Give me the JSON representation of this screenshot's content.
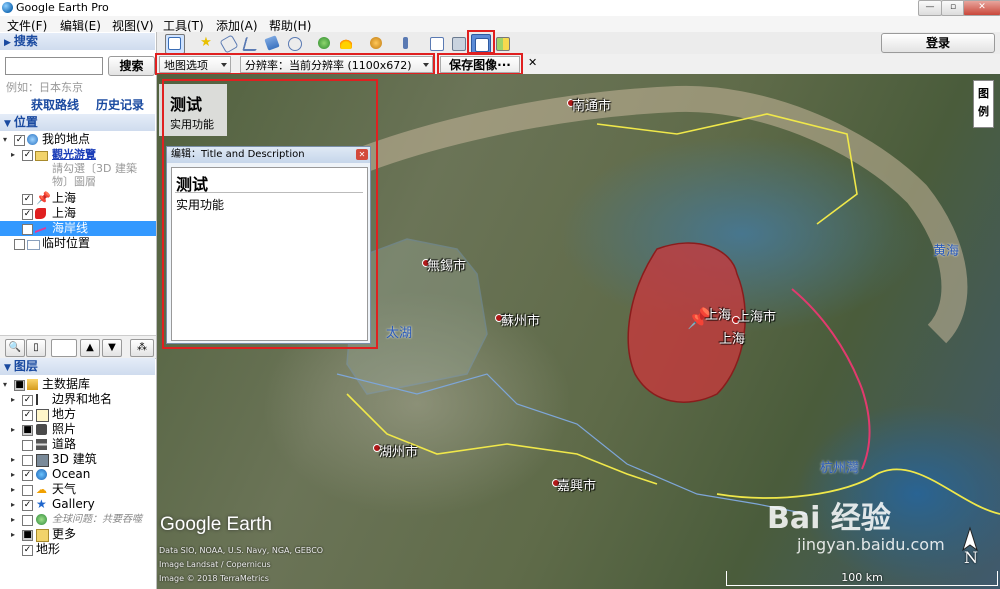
{
  "window": {
    "title": "Google Earth Pro",
    "min_label": "—",
    "max_label": "▫",
    "close_label": "✕"
  },
  "menu": [
    "文件(F)",
    "编辑(E)",
    "视图(V)",
    "工具(T)",
    "添加(A)",
    "帮助(H)"
  ],
  "toolbar": {
    "login_label": "登录"
  },
  "save_row": {
    "map_options": "地图选项",
    "resolution": "分辨率：当前分辨率 (1100x672)",
    "save_label": "保存图像···",
    "close_label": "✕"
  },
  "search": {
    "header": "搜索",
    "button": "搜索",
    "hint": "例如：日本东京",
    "get_directions": "获取路线",
    "history": "历史记录"
  },
  "places": {
    "header": "位置",
    "items": [
      {
        "label": "我的地点"
      },
      {
        "label": "觀光游覽"
      },
      {
        "label": "請勾選〔3D 建築物〕圖層"
      },
      {
        "label": "上海"
      },
      {
        "label": "上海"
      },
      {
        "label": "海岸线"
      },
      {
        "label": "临时位置"
      }
    ]
  },
  "layers": {
    "header": "图层",
    "items": [
      {
        "label": "主数据库"
      },
      {
        "label": "边界和地名"
      },
      {
        "label": "地方"
      },
      {
        "label": "照片"
      },
      {
        "label": "道路"
      },
      {
        "label": "3D 建筑"
      },
      {
        "label": "Ocean"
      },
      {
        "label": "天气"
      },
      {
        "label": "Gallery"
      },
      {
        "label": "全球问题：共要吞噬"
      },
      {
        "label": "更多"
      },
      {
        "label": "地形"
      }
    ]
  },
  "map": {
    "legend": "图例",
    "overlay_title": "测试",
    "overlay_subtitle": "实用功能",
    "edit_dialog": {
      "header": "编辑：Title and Description",
      "title": "测试",
      "desc": "实用功能"
    },
    "cities": [
      "南通市",
      "無錫市",
      "蘇州市",
      "上海",
      "上海市",
      "上海",
      "湖州市",
      "嘉興市",
      "杭州灣",
      "黄海"
    ],
    "lake": "太湖",
    "logo": "Google Earth",
    "attribution": [
      "Data SIO, NOAA, U.S. Navy, NGA, GEBCO",
      "Image Landsat / Copernicus",
      "Image © 2018 TerraMetrics"
    ],
    "scale": "100 km",
    "compass": "N",
    "watermark_main": "Bai 经验",
    "watermark_url": "jingyan.baidu.com"
  },
  "colors": {
    "highlight": "#e02020",
    "shanghai_fill": "#c8383c",
    "boundary": "#f0e84a",
    "coast": "#e23a6e",
    "river": "#6aa6e8"
  }
}
